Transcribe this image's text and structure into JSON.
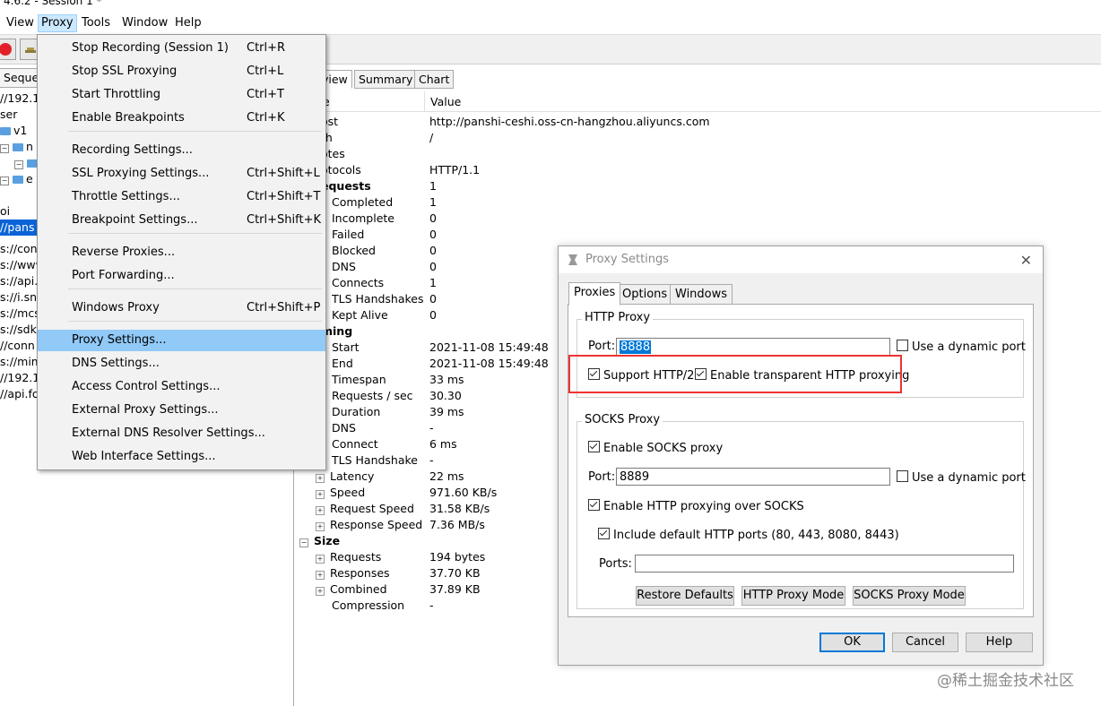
{
  "window": {
    "title": "4.6.2 - Session 1 *"
  },
  "menubar": {
    "items": [
      {
        "label": "View"
      },
      {
        "label": "Proxy"
      },
      {
        "label": "Tools"
      },
      {
        "label": "Window"
      },
      {
        "label": "Help"
      }
    ]
  },
  "left": {
    "tab": "Seque",
    "tree": [
      "//192.1",
      "ser",
      "v1",
      "n",
      "",
      "e",
      "",
      "oi",
      "//pans",
      "s://cont",
      "s://www",
      "s://api.j",
      "s://i.sns",
      "s://mcs",
      "s://sdk-",
      "//conn",
      "s://mim",
      "//192.1",
      "//api.fo"
    ]
  },
  "right": {
    "tabs": [
      "view",
      "Summary",
      "Chart"
    ],
    "col_name": "e",
    "col_value": "Value",
    "rows": [
      {
        "k": "ost",
        "v": "http://panshi-ceshi.oss-cn-hangzhou.aliyuncs.com"
      },
      {
        "k": "th",
        "v": "/"
      },
      {
        "k": "otes",
        "v": ""
      },
      {
        "k": "otocols",
        "v": "HTTP/1.1"
      },
      {
        "k": "equests",
        "v": "1"
      },
      {
        "k": "Completed",
        "v": "1"
      },
      {
        "k": "Incomplete",
        "v": "0"
      },
      {
        "k": "Failed",
        "v": "0"
      },
      {
        "k": "Blocked",
        "v": "0"
      },
      {
        "k": "DNS",
        "v": "0"
      },
      {
        "k": "Connects",
        "v": "1"
      },
      {
        "k": "TLS Handshakes",
        "v": "0"
      },
      {
        "k": "Kept Alive",
        "v": "0"
      },
      {
        "k": "ming",
        "v": ""
      },
      {
        "k": "Start",
        "v": "2021-11-08 15:49:48"
      },
      {
        "k": "End",
        "v": "2021-11-08 15:49:48"
      },
      {
        "k": "Timespan",
        "v": "33 ms"
      },
      {
        "k": "Requests / sec",
        "v": "30.30"
      },
      {
        "k": "Duration",
        "v": "39 ms"
      },
      {
        "k": "DNS",
        "v": "-"
      },
      {
        "k": "Connect",
        "v": "6 ms"
      },
      {
        "k": "TLS Handshake",
        "v": "-"
      },
      {
        "k": "Latency",
        "v": "22 ms"
      },
      {
        "k": "Speed",
        "v": "971.60 KB/s"
      },
      {
        "k": "Request Speed",
        "v": "31.58 KB/s"
      },
      {
        "k": "Response Speed",
        "v": "7.36 MB/s"
      },
      {
        "k": "Size",
        "v": ""
      },
      {
        "k": "Requests",
        "v": "194 bytes"
      },
      {
        "k": "Responses",
        "v": "37.70 KB"
      },
      {
        "k": "Combined",
        "v": "37.89 KB"
      },
      {
        "k": "Compression",
        "v": "-"
      }
    ]
  },
  "proxy_menu": {
    "items": [
      {
        "label": "Stop Recording (Session 1)",
        "shortcut": "Ctrl+R"
      },
      {
        "label": "Stop SSL Proxying",
        "shortcut": "Ctrl+L"
      },
      {
        "label": "Start Throttling",
        "shortcut": "Ctrl+T"
      },
      {
        "label": "Enable Breakpoints",
        "shortcut": "Ctrl+K"
      },
      {
        "label": "Recording Settings...",
        "shortcut": ""
      },
      {
        "label": "SSL Proxying Settings...",
        "shortcut": "Ctrl+Shift+L"
      },
      {
        "label": "Throttle Settings...",
        "shortcut": "Ctrl+Shift+T"
      },
      {
        "label": "Breakpoint Settings...",
        "shortcut": "Ctrl+Shift+K"
      },
      {
        "label": "Reverse Proxies...",
        "shortcut": ""
      },
      {
        "label": "Port Forwarding...",
        "shortcut": ""
      },
      {
        "label": "Windows Proxy",
        "shortcut": "Ctrl+Shift+P"
      },
      {
        "label": "Proxy Settings...",
        "shortcut": ""
      },
      {
        "label": "DNS Settings...",
        "shortcut": ""
      },
      {
        "label": "Access Control Settings...",
        "shortcut": ""
      },
      {
        "label": "External Proxy Settings...",
        "shortcut": ""
      },
      {
        "label": "External DNS Resolver Settings...",
        "shortcut": ""
      },
      {
        "label": "Web Interface Settings...",
        "shortcut": ""
      }
    ]
  },
  "dialog": {
    "title": "Proxy Settings",
    "tabs": [
      "Proxies",
      "Options",
      "Windows"
    ],
    "http_proxy": {
      "legend": "HTTP Proxy",
      "port_label": "Port:",
      "port_value": "8888",
      "dynamic_port": "Use a dynamic port",
      "support_http2": "Support HTTP/2",
      "transparent": "Enable transparent HTTP proxying"
    },
    "socks_proxy": {
      "legend": "SOCKS Proxy",
      "enable": "Enable SOCKS proxy",
      "port_label": "Port:",
      "port_value": "8889",
      "dynamic_port": "Use a dynamic port",
      "http_over_socks": "Enable HTTP proxying over SOCKS",
      "include_default": "Include default HTTP ports (80, 443, 8080, 8443)",
      "ports_label": "Ports:",
      "ports_value": ""
    },
    "buttons": {
      "restore": "Restore Defaults",
      "http_mode": "HTTP Proxy Mode",
      "socks_mode": "SOCKS Proxy Mode",
      "ok": "OK",
      "cancel": "Cancel",
      "help": "Help"
    }
  },
  "watermark": "@稀土掘金技术社区"
}
